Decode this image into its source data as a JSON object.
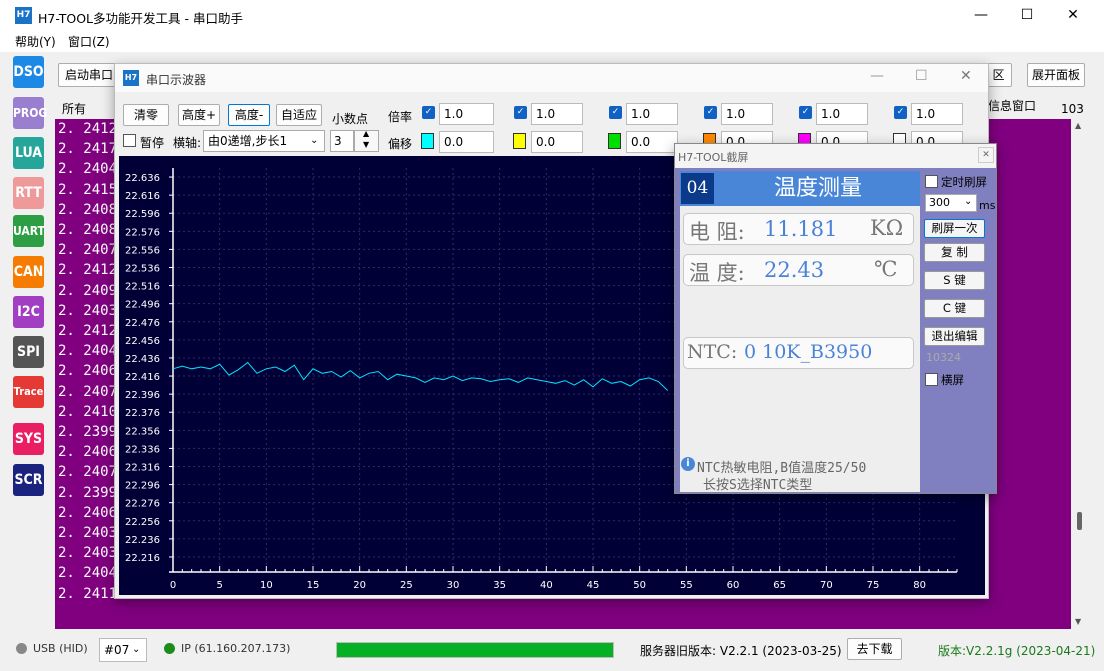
{
  "app": {
    "icon": "H7",
    "title": "H7-TOOL多功能开发工具 - 串口助手",
    "controls": {
      "minimize": "—",
      "maximize": "☐",
      "close": "✕"
    }
  },
  "menu": [
    "帮助(Y)",
    "窗口(Z)"
  ],
  "sidebar": [
    {
      "label": "DSO",
      "color": "#1e88e5"
    },
    {
      "label": "PROG",
      "color": "#9a7fd1"
    },
    {
      "label": "LUA",
      "color": "#26a69a"
    },
    {
      "label": "RTT",
      "color": "#ef9a9a"
    },
    {
      "label": "UART",
      "color": "#2e9e44"
    },
    {
      "label": "CAN",
      "color": "#f57c00"
    },
    {
      "label": "I2C",
      "color": "#a13ec1"
    },
    {
      "label": "SPI",
      "color": "#555555"
    },
    {
      "label": "Trace",
      "color": "#e53935"
    },
    {
      "label": "SYS",
      "color": "#e91e63"
    },
    {
      "label": "SCR",
      "color": "#1a237e"
    }
  ],
  "toolbar": {
    "start_serial": "启动串口",
    "area_tail": "区",
    "expand_panel": "展开面板",
    "tab_all": "所有",
    "info_window": "信息窗口",
    "count": "103"
  },
  "log_lines": [
    "2. 2412",
    "2. 2417",
    "2. 2404",
    "2. 2415",
    "2. 2408",
    "2. 2408",
    "2. 2407",
    "2. 2412",
    "2. 2409",
    "2. 2403",
    "2. 2412",
    "2. 2404",
    "2. 2406",
    "2. 2407",
    "2. 2410",
    "2. 2399",
    "2. 2406",
    "2. 2407",
    "2. 2399",
    "2. 2406",
    "2. 2403",
    "2. 2403",
    "2. 2404",
    "2. 2411"
  ],
  "scope": {
    "icon": "H7",
    "title": "串口示波器",
    "buttons": {
      "clear": "清零",
      "height_up": "高度+",
      "height_down": "高度-",
      "auto_fit": "自适应"
    },
    "decimals_label": "小数点",
    "decimals_value": "3",
    "pause_label": "暂停",
    "xaxis_label": "横轴:",
    "xaxis_value": "由0递增,步长1",
    "multiplier_label": "倍率",
    "offset_label": "偏移",
    "channels": [
      {
        "scale": "1.0",
        "offset": "0.0",
        "color": "#00ffff"
      },
      {
        "scale": "1.0",
        "offset": "0.0",
        "color": "#ffff00"
      },
      {
        "scale": "1.0",
        "offset": "0.0",
        "color": "#00dd00"
      },
      {
        "scale": "1.0",
        "offset": "0.0",
        "color": "#ff8800"
      },
      {
        "scale": "1.0",
        "offset": "0.0",
        "color": "#ff00ff"
      },
      {
        "scale": "1.0",
        "offset": "0.0",
        "color": "#ffffff"
      }
    ]
  },
  "chart_data": {
    "type": "line",
    "title": "",
    "xlabel": "",
    "ylabel": "",
    "ylim": [
      22.206,
      22.646
    ],
    "xlim": [
      0,
      84
    ],
    "grid": true,
    "y_ticks": [
      "22.636",
      "22.616",
      "22.596",
      "22.576",
      "22.556",
      "22.536",
      "22.516",
      "22.496",
      "22.476",
      "22.456",
      "22.436",
      "22.416",
      "22.396",
      "22.376",
      "22.356",
      "22.336",
      "22.316",
      "22.296",
      "22.276",
      "22.256",
      "22.236",
      "22.216"
    ],
    "x_ticks": [
      0,
      5,
      10,
      15,
      20,
      25,
      30,
      35,
      40,
      45,
      50,
      55,
      60,
      65,
      70,
      75,
      80
    ],
    "series": [
      {
        "color": "#00e5ff",
        "x": [
          0,
          1,
          2,
          3,
          4,
          5,
          6,
          7,
          8,
          9,
          10,
          11,
          12,
          13,
          14,
          15,
          16,
          17,
          18,
          19,
          20,
          21,
          22,
          23,
          24,
          25,
          26,
          27,
          28,
          29,
          30,
          31,
          32,
          33,
          34,
          35,
          36,
          37,
          38,
          39,
          40,
          41,
          42,
          43,
          44,
          45,
          46,
          47,
          48,
          49,
          50,
          51,
          52,
          53
        ],
        "y": [
          22.424,
          22.427,
          22.424,
          22.426,
          22.424,
          22.429,
          22.417,
          22.423,
          22.431,
          22.419,
          22.424,
          22.426,
          22.421,
          22.428,
          22.412,
          22.424,
          22.419,
          22.421,
          22.415,
          22.422,
          22.414,
          22.419,
          22.421,
          22.412,
          22.418,
          22.416,
          22.414,
          22.409,
          22.414,
          22.412,
          22.416,
          22.411,
          22.414,
          22.413,
          22.41,
          22.412,
          22.413,
          22.409,
          22.414,
          22.412,
          22.41,
          22.408,
          22.411,
          22.406,
          22.412,
          22.404,
          22.413,
          22.408,
          22.41,
          22.405,
          22.412,
          22.414,
          22.41,
          22.4
        ]
      }
    ]
  },
  "screenshot": {
    "title": "H7-TOOL截屏",
    "close": "✕",
    "lcd": {
      "page_no": "04",
      "heading": "温度测量",
      "resistance_label": "电 阻:",
      "resistance_value": "11.181",
      "resistance_unit": "KΩ",
      "temperature_label": "温 度:",
      "temperature_value": "22.43",
      "temperature_unit": "℃",
      "ntc_label": "NTC:",
      "ntc_value": "0 10K_B3950",
      "info_line1": "NTC热敏电阻,B值温度25/50",
      "info_line2": "长按S选择NTC类型"
    },
    "timer_refresh_label": "定时刷屏",
    "interval_value": "300",
    "interval_unit": "ms",
    "refresh_once": "刷屏一次",
    "copy": "复 制",
    "s_key": "S 键",
    "c_key": "C 键",
    "exit_edit": "退出编辑",
    "counter": "10324",
    "landscape_label": "横屏"
  },
  "status": {
    "usb": "USB (HID)",
    "device": "#07",
    "ip": "IP (61.160.207.173)",
    "progress": 1.0,
    "server_version": "服务器旧版本: V2.2.1 (2023-03-25)",
    "download": "去下载",
    "local_version": "版本:V2.2.1g (2023-04-21)"
  }
}
